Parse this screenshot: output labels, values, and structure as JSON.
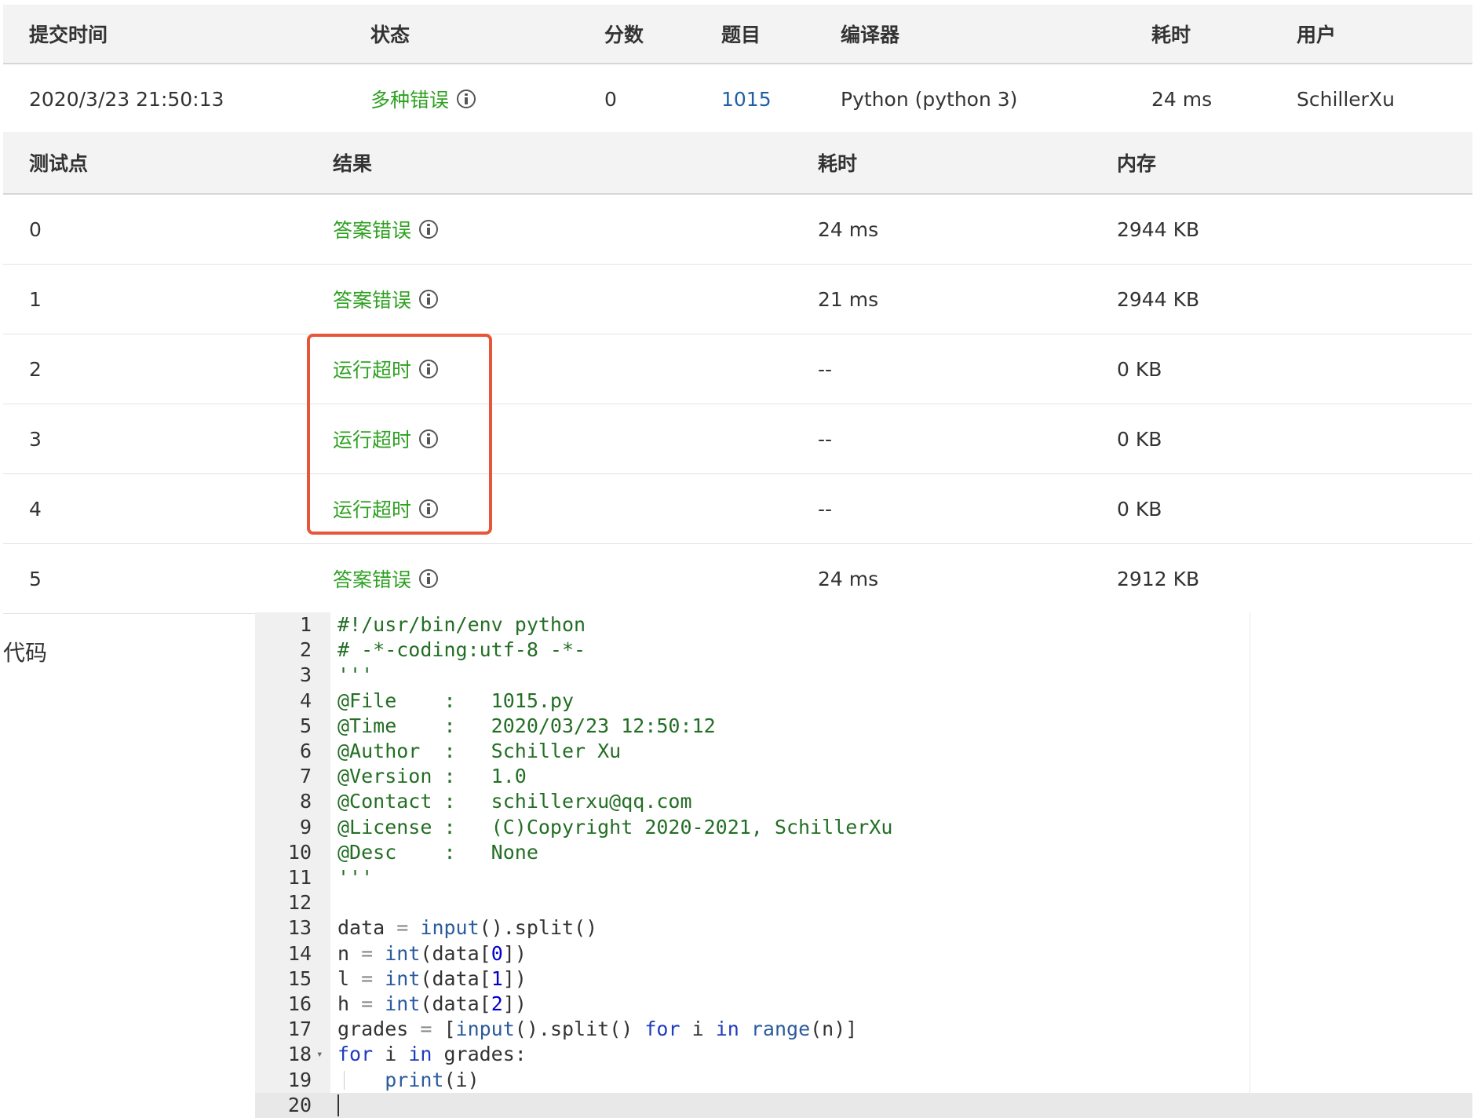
{
  "submission": {
    "headers": [
      "提交时间",
      "状态",
      "分数",
      "题目",
      "编译器",
      "耗时",
      "用户"
    ],
    "time": "2020/3/23 21:50:13",
    "status": "多种错误",
    "score": "0",
    "problem": "1015",
    "compiler": "Python (python 3)",
    "elapsed": "24 ms",
    "user": "SchillerXu"
  },
  "tests": {
    "headers": [
      "测试点",
      "结果",
      "耗时",
      "内存"
    ],
    "rows": [
      {
        "id": "0",
        "result": "答案错误",
        "time": "24 ms",
        "memory": "2944 KB"
      },
      {
        "id": "1",
        "result": "答案错误",
        "time": "21 ms",
        "memory": "2944 KB"
      },
      {
        "id": "2",
        "result": "运行超时",
        "time": "--",
        "memory": "0 KB"
      },
      {
        "id": "3",
        "result": "运行超时",
        "time": "--",
        "memory": "0 KB"
      },
      {
        "id": "4",
        "result": "运行超时",
        "time": "--",
        "memory": "0 KB"
      },
      {
        "id": "5",
        "result": "答案错误",
        "time": "24 ms",
        "memory": "2912 KB"
      }
    ]
  },
  "code": {
    "label": "代码",
    "lines": [
      "#!/usr/bin/env python",
      "# -*-coding:utf-8 -*-",
      "'''",
      "@File    :   1015.py",
      "@Time    :   2020/03/23 12:50:12",
      "@Author  :   Schiller Xu",
      "@Version :   1.0",
      "@Contact :   schillerxu@qq.com",
      "@License :   (C)Copyright 2020-2021, SchillerXu",
      "@Desc    :   None",
      "'''",
      "",
      "data = input().split()",
      "n = int(data[0])",
      "l = int(data[1])",
      "h = int(data[2])",
      "grades = [input().split() for i in range(n)]",
      "for i in grades:",
      "    print(i)",
      ""
    ]
  }
}
